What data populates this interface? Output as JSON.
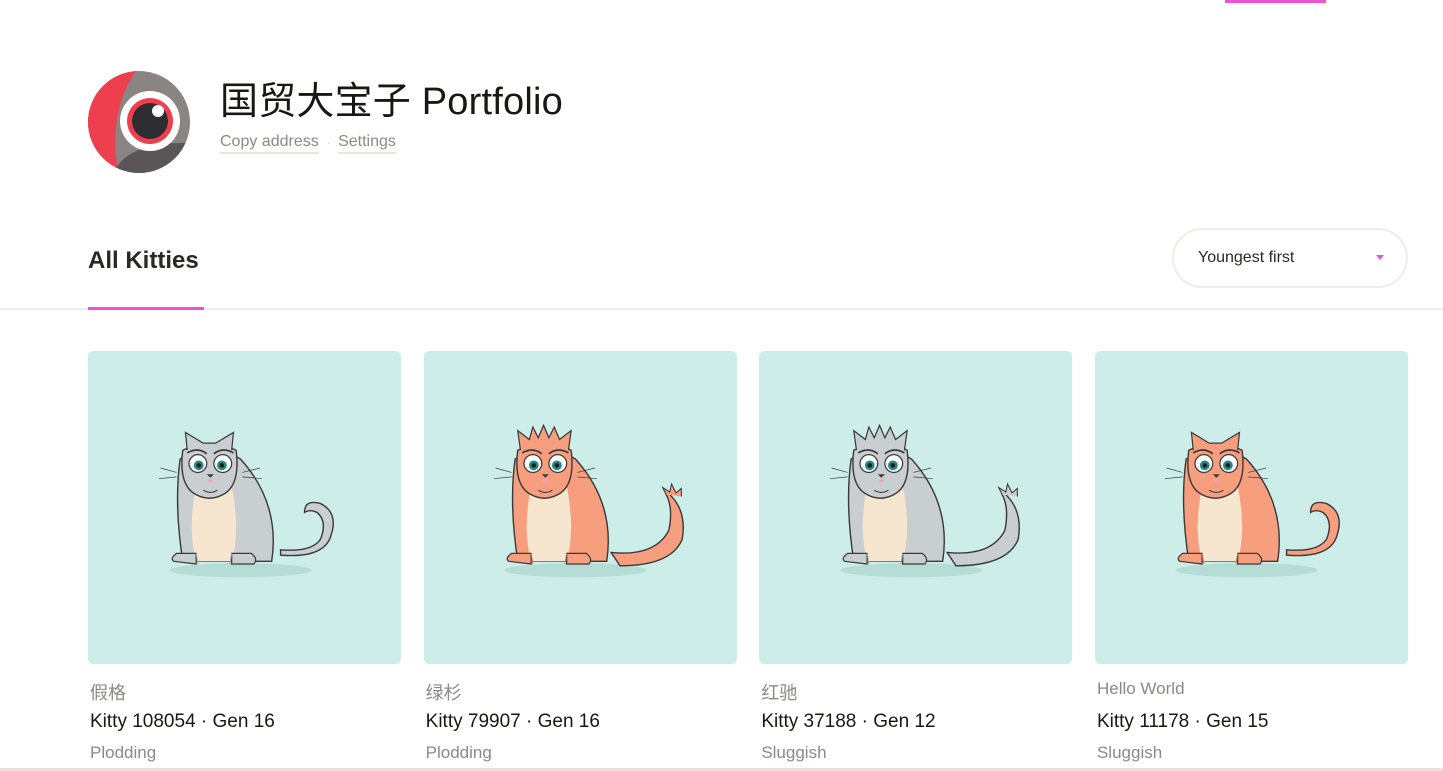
{
  "profile": {
    "title": "国贸大宝子 Portfolio",
    "copy_address": "Copy address",
    "settings": "Settings",
    "separator": "·"
  },
  "tabs": {
    "all_kitties": "All Kitties"
  },
  "sort": {
    "selected": "Youngest first"
  },
  "colors": {
    "accent": "#ef52d1",
    "card_bg": "#cdeee8",
    "orange_cat": "#f79e7f",
    "gray_cat": "#c9ced1"
  },
  "kitties": [
    {
      "name": "假格",
      "id_line": "Kitty 108054 · Gen 16",
      "speed": "Plodding",
      "color": "gray"
    },
    {
      "name": "绿杉",
      "id_line": "Kitty 79907 · Gen 16",
      "speed": "Plodding",
      "color": "orange"
    },
    {
      "name": "红驰",
      "id_line": "Kitty 37188 · Gen 12",
      "speed": "Sluggish",
      "color": "gray"
    },
    {
      "name": "Hello World",
      "id_line": "Kitty 11178 · Gen 15",
      "speed": "Sluggish",
      "color": "orange"
    }
  ]
}
